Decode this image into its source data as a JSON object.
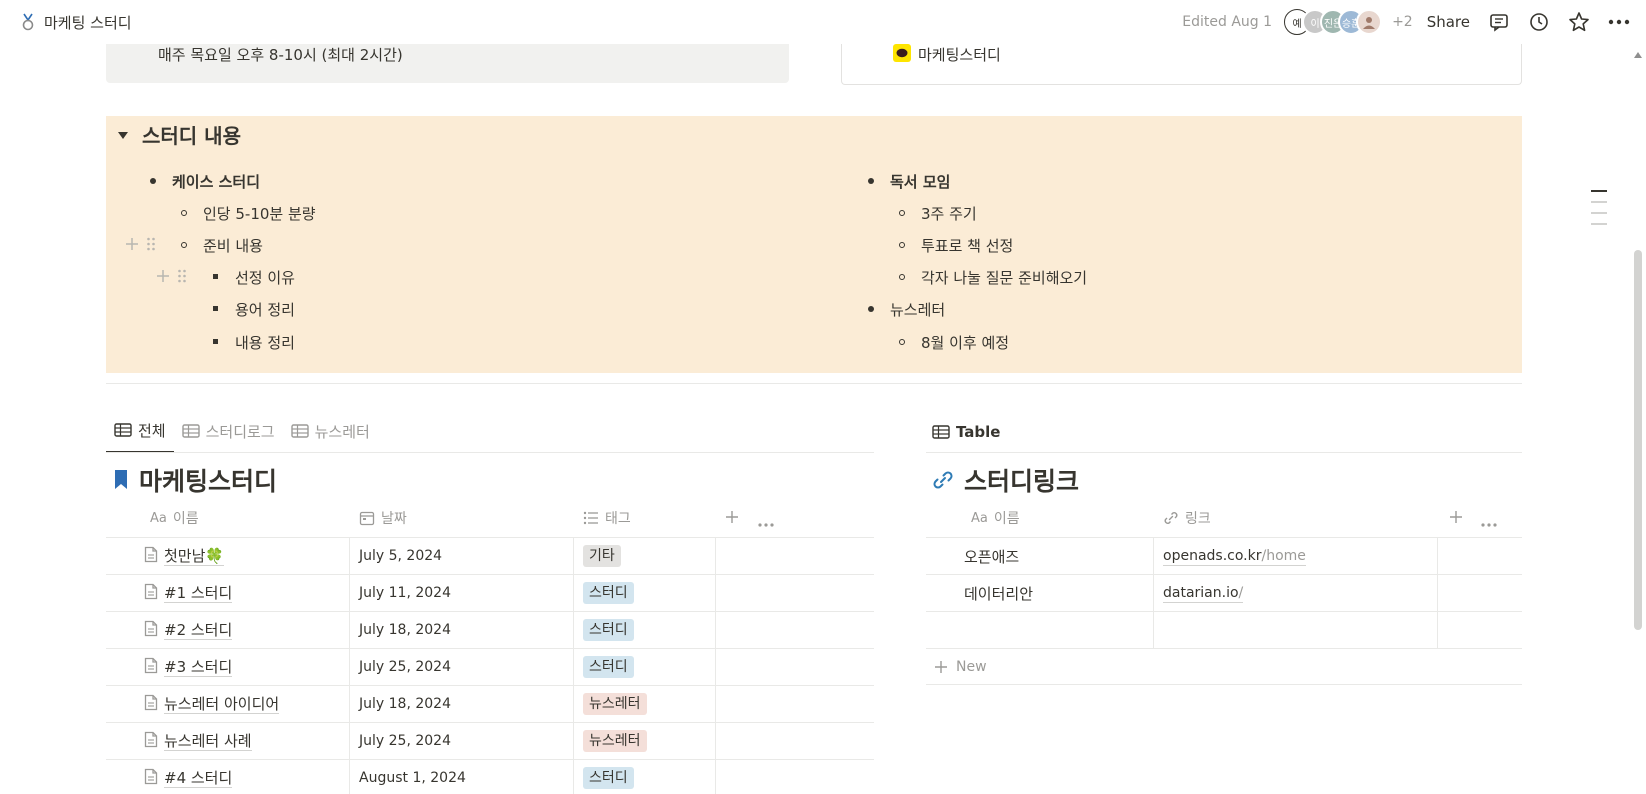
{
  "topbar": {
    "title": "마케팅 스터디",
    "edited": "Edited Aug 1",
    "avatar_first": "예",
    "avatar_2": "이",
    "avatar_3": "진은",
    "avatar_4": "승훈",
    "more_count": "+2",
    "share_label": "Share"
  },
  "schedule_box": {
    "text": "매주 목요일 오후 8-10시 (최대 2시간)"
  },
  "channel_box": {
    "text": "마케팅스터디"
  },
  "toggle": {
    "heading": "스터디 내용",
    "left": {
      "item1": "케이스 스터디",
      "item1_sub1": "인당 5-10분 분량",
      "item1_sub2": "준비 내용",
      "item1_sub2_a": "선정 이유",
      "item1_sub2_b": "용어 정리",
      "item1_sub2_c": "내용 정리"
    },
    "right": {
      "item1": "독서 모임",
      "item1_sub1": "3주 주기",
      "item1_sub2": "투표로 책 선정",
      "item1_sub3": "각자 나눌 질문 준비해오기",
      "item2": "뉴스레터",
      "item2_sub1": "8월 이후 예정"
    }
  },
  "study_db": {
    "tabs": [
      "전체",
      "스터디로그",
      "뉴스레터"
    ],
    "title": "마케팅스터디",
    "columns": {
      "name": "이름",
      "name_prefix": "Aa",
      "date": "날짜",
      "tag": "태그"
    },
    "rows": [
      {
        "name": "첫만남🍀",
        "date": "July 5, 2024",
        "tag": "기타"
      },
      {
        "name": "#1 스터디",
        "date": "July 11, 2024",
        "tag": "스터디"
      },
      {
        "name": "#2 스터디",
        "date": "July 18, 2024",
        "tag": "스터디"
      },
      {
        "name": "#3 스터디",
        "date": "July 25, 2024",
        "tag": "스터디"
      },
      {
        "name": "뉴스레터 아이디어",
        "date": "July 18, 2024",
        "tag": "뉴스레터"
      },
      {
        "name": "뉴스레터 사례",
        "date": "July 25, 2024",
        "tag": "뉴스레터"
      },
      {
        "name": "#4 스터디",
        "date": "August 1, 2024",
        "tag": "스터디"
      }
    ],
    "tag_colors": {
      "기타": "#e3e2e0",
      "스터디": "#d3e5ef",
      "뉴스레터": "#f4dfd9"
    }
  },
  "link_db": {
    "view_label": "Table",
    "title": "스터디링크",
    "columns": {
      "name": "이름",
      "name_prefix": "Aa",
      "link": "링크"
    },
    "rows": [
      {
        "name": "오픈애즈",
        "link_main": "openads.co.kr",
        "link_rest": "/home"
      },
      {
        "name": "데이터리안",
        "link_main": "datarian.io",
        "link_rest": "/"
      }
    ],
    "new_label": "New"
  },
  "colors": {
    "callout_bg": "#fbecd6",
    "text": "#37352f",
    "muted": "#9b9a97",
    "bookmark": "#2e6db4",
    "link_icon": "#2e7bb5"
  }
}
